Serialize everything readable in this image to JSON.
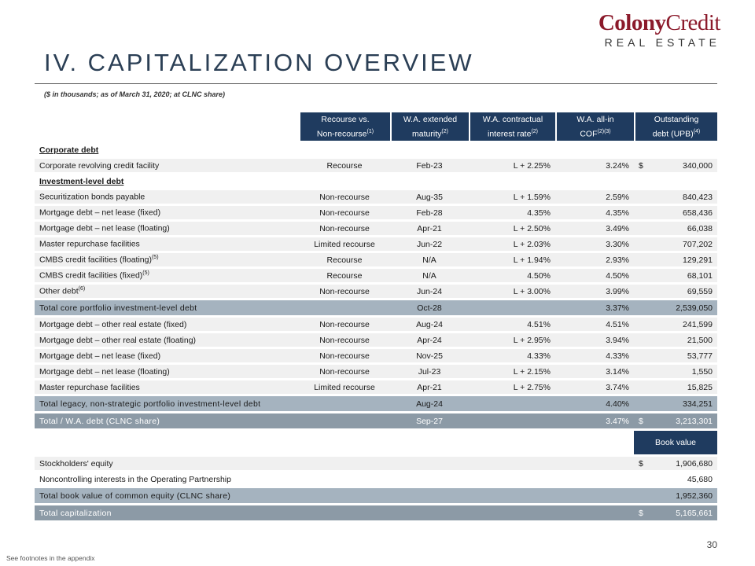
{
  "logo": {
    "brand_bold": "Colony",
    "brand_rest": "Credit",
    "sub": "REAL ESTATE"
  },
  "title": "IV. CAPITALIZATION OVERVIEW",
  "subtitle": "($ in thousands; as of March 31, 2020; at CLNC share)",
  "headers": {
    "h1": {
      "line1": "Recourse vs.",
      "line2": "Non-recourse",
      "fn": "(1)"
    },
    "h2": {
      "line1": "W.A. extended",
      "line2": "maturity",
      "fn": "(2)"
    },
    "h3": {
      "line1": "W.A. contractual",
      "line2": "interest rate",
      "fn": "(2)"
    },
    "h4": {
      "line1": "W.A. all-in",
      "line2": "COF",
      "fn": "(2)(3)"
    },
    "h5": {
      "line1": "Outstanding",
      "line2": "debt (UPB)",
      "fn": "(4)"
    }
  },
  "sections": {
    "corporate": "Corporate debt",
    "investment": "Investment-level debt"
  },
  "corp_rows": [
    {
      "name": "Corporate revolving credit facility",
      "fn": "",
      "recourse": "Recourse",
      "maturity": "Feb-23",
      "rate": "L + 2.25%",
      "cof": "3.24%",
      "dollar": "$",
      "upb": "340,000"
    }
  ],
  "inv_rows": [
    {
      "name": "Securitization bonds payable",
      "fn": "",
      "recourse": "Non-recourse",
      "maturity": "Aug-35",
      "rate": "L + 1.59%",
      "cof": "2.59%",
      "upb": "840,423"
    },
    {
      "name": "Mortgage debt – net lease (fixed)",
      "fn": "",
      "recourse": "Non-recourse",
      "maturity": "Feb-28",
      "rate": "4.35%",
      "cof": "4.35%",
      "upb": "658,436"
    },
    {
      "name": "Mortgage debt – net lease (floating)",
      "fn": "",
      "recourse": "Non-recourse",
      "maturity": "Apr-21",
      "rate": "L + 2.50%",
      "cof": "3.49%",
      "upb": "66,038"
    },
    {
      "name": "Master repurchase facilities",
      "fn": "",
      "recourse": "Limited recourse",
      "maturity": "Jun-22",
      "rate": "L + 2.03%",
      "cof": "3.30%",
      "upb": "707,202"
    },
    {
      "name": "CMBS credit facilities (floating)",
      "fn": "(5)",
      "recourse": "Recourse",
      "maturity": "N/A",
      "rate": "L + 1.94%",
      "cof": "2.93%",
      "upb": "129,291"
    },
    {
      "name": "CMBS credit facilities (fixed)",
      "fn": "(5)",
      "recourse": "Recourse",
      "maturity": "N/A",
      "rate": "4.50%",
      "cof": "4.50%",
      "upb": "68,101"
    },
    {
      "name": "Other debt",
      "fn": "(6)",
      "recourse": "Non-recourse",
      "maturity": "Jun-24",
      "rate": "L + 3.00%",
      "cof": "3.99%",
      "upb": "69,559"
    }
  ],
  "total_core": {
    "label": "Total core portfolio investment-level debt",
    "maturity": "Oct-28",
    "cof": "3.37%",
    "upb": "2,539,050"
  },
  "legacy_rows": [
    {
      "name": "Mortgage debt – other real estate (fixed)",
      "recourse": "Non-recourse",
      "maturity": "Aug-24",
      "rate": "4.51%",
      "cof": "4.51%",
      "upb": "241,599"
    },
    {
      "name": "Mortgage debt – other real estate (floating)",
      "recourse": "Non-recourse",
      "maturity": "Apr-24",
      "rate": "L + 2.95%",
      "cof": "3.94%",
      "upb": "21,500"
    },
    {
      "name": "Mortgage debt – net lease (fixed)",
      "recourse": "Non-recourse",
      "maturity": "Nov-25",
      "rate": "4.33%",
      "cof": "4.33%",
      "upb": "53,777"
    },
    {
      "name": "Mortgage debt – net lease (floating)",
      "recourse": "Non-recourse",
      "maturity": "Jul-23",
      "rate": "L + 2.15%",
      "cof": "3.14%",
      "upb": "1,550"
    },
    {
      "name": "Master repurchase facilities",
      "recourse": "Limited recourse",
      "maturity": "Apr-21",
      "rate": "L + 2.75%",
      "cof": "3.74%",
      "upb": "15,825"
    }
  ],
  "total_legacy": {
    "label": "Total legacy, non-strategic portfolio investment-level debt",
    "maturity": "Aug-24",
    "cof": "4.40%",
    "upb": "334,251"
  },
  "total_debt": {
    "label": "Total / W.A. debt (CLNC share)",
    "maturity": "Sep-27",
    "cof": "3.47%",
    "dollar": "$",
    "upb": "3,213,301"
  },
  "book_header": "Book value",
  "equity_rows": [
    {
      "name": "Stockholders' equity",
      "dollar": "$",
      "value": "1,906,680"
    },
    {
      "name": "Noncontrolling interests in the Operating Partnership",
      "dollar": "",
      "value": "45,680"
    }
  ],
  "total_book": {
    "label": "Total book value of common equity (CLNC share)",
    "value": "1,952,360"
  },
  "total_cap": {
    "label": "Total capitalization",
    "dollar": "$",
    "value": "5,165,661"
  },
  "page_number": "30",
  "footnote": "See footnotes in the appendix",
  "colors": {
    "navy": "#1f3b5f",
    "burgundy": "#8b1a2b",
    "total": "#a5b3bf",
    "grand": "#8c9aa6"
  }
}
